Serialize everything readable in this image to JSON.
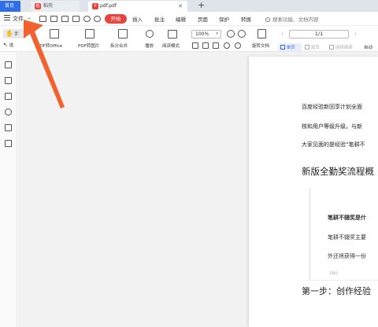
{
  "tabs": {
    "home": "首页",
    "daoke": "稻壳",
    "pdf": "pdf.pdf",
    "add": "+"
  },
  "menu": {
    "file": "文件",
    "start": "开始",
    "items": [
      "插入",
      "批注",
      "编辑",
      "页面",
      "保护",
      "转换"
    ],
    "search": "搜索功能、文档内容"
  },
  "toolbar": {
    "hand": "手",
    "select": "选",
    "pdf_to_office": "PDF转Office",
    "pdf_to_image": "PDF转图片",
    "split_merge": "拆分合并",
    "play": "播放",
    "read_mode": "阅读模式",
    "zoom": "100%",
    "rotate": "旋转文档",
    "single": "单页",
    "double": "双页",
    "continuous": "连续阅读",
    "auto": "自动",
    "page": "1/1"
  },
  "document": {
    "line1": "百度经验新回享计划全面",
    "line2": "核和用户等级升级。与新",
    "line3": "大家见面的是经验“笔耕不",
    "heading1": "新版全勤奖流程概",
    "quote_title": "笔耕不辍奖是什",
    "quote_line1": "笔耕不辍奖主要",
    "quote_line2": "外还将获得一份",
    "quote_end": "END",
    "heading2": "第一步：创作经验"
  },
  "colors": {
    "accent_blue": "#2f6ee8",
    "accent_red": "#e8443f",
    "arrow_orange": "#f2622e"
  }
}
